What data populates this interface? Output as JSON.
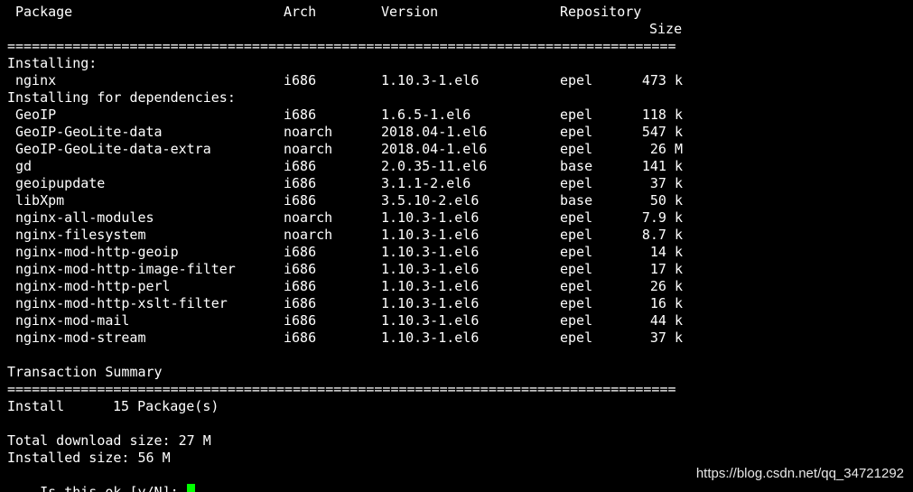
{
  "header": {
    "package": "Package",
    "arch": "Arch",
    "version": "Version",
    "repository": "Repository",
    "size": "Size"
  },
  "separator": "==================================================================================",
  "sections": {
    "installing": "Installing:",
    "dependencies": "Installing for dependencies:",
    "summary": "Transaction Summary"
  },
  "install_rows": [
    {
      "name": "nginx",
      "arch": "i686",
      "version": "1.10.3-1.el6",
      "repo": "epel",
      "size": "473 k"
    }
  ],
  "dependency_rows": [
    {
      "name": "GeoIP",
      "arch": "i686",
      "version": "1.6.5-1.el6",
      "repo": "epel",
      "size": "118 k"
    },
    {
      "name": "GeoIP-GeoLite-data",
      "arch": "noarch",
      "version": "2018.04-1.el6",
      "repo": "epel",
      "size": "547 k"
    },
    {
      "name": "GeoIP-GeoLite-data-extra",
      "arch": "noarch",
      "version": "2018.04-1.el6",
      "repo": "epel",
      "size": "26 M"
    },
    {
      "name": "gd",
      "arch": "i686",
      "version": "2.0.35-11.el6",
      "repo": "base",
      "size": "141 k"
    },
    {
      "name": "geoipupdate",
      "arch": "i686",
      "version": "3.1.1-2.el6",
      "repo": "epel",
      "size": "37 k"
    },
    {
      "name": "libXpm",
      "arch": "i686",
      "version": "3.5.10-2.el6",
      "repo": "base",
      "size": "50 k"
    },
    {
      "name": "nginx-all-modules",
      "arch": "noarch",
      "version": "1.10.3-1.el6",
      "repo": "epel",
      "size": "7.9 k"
    },
    {
      "name": "nginx-filesystem",
      "arch": "noarch",
      "version": "1.10.3-1.el6",
      "repo": "epel",
      "size": "8.7 k"
    },
    {
      "name": "nginx-mod-http-geoip",
      "arch": "i686",
      "version": "1.10.3-1.el6",
      "repo": "epel",
      "size": "14 k"
    },
    {
      "name": "nginx-mod-http-image-filter",
      "arch": "i686",
      "version": "1.10.3-1.el6",
      "repo": "epel",
      "size": "17 k"
    },
    {
      "name": "nginx-mod-http-perl",
      "arch": "i686",
      "version": "1.10.3-1.el6",
      "repo": "epel",
      "size": "26 k"
    },
    {
      "name": "nginx-mod-http-xslt-filter",
      "arch": "i686",
      "version": "1.10.3-1.el6",
      "repo": "epel",
      "size": "16 k"
    },
    {
      "name": "nginx-mod-mail",
      "arch": "i686",
      "version": "1.10.3-1.el6",
      "repo": "epel",
      "size": "44 k"
    },
    {
      "name": "nginx-mod-stream",
      "arch": "i686",
      "version": "1.10.3-1.el6",
      "repo": "epel",
      "size": "37 k"
    }
  ],
  "summary": {
    "install_label": "Install",
    "install_count": "15 Package(s)",
    "download_size": "Total download size: 27 M",
    "installed_size": "Installed size: 56 M",
    "prompt": "Is this ok [y/N]: "
  },
  "watermark": "https://blog.csdn.net/qq_34721292",
  "colors": {
    "background": "#000000",
    "text": "#ffffff",
    "cursor": "#00ff00"
  }
}
